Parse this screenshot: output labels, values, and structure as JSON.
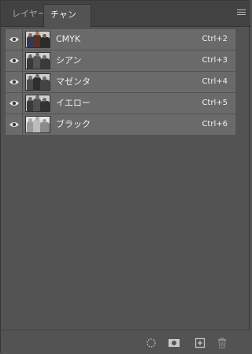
{
  "tabs": [
    {
      "label": "レイヤー",
      "active": false
    },
    {
      "label": "チャンネル",
      "active": true
    }
  ],
  "channels": [
    {
      "name": "CMYK",
      "shortcut": "Ctrl+2",
      "thumb": "composite-cmyk"
    },
    {
      "name": "シアン",
      "shortcut": "Ctrl+3",
      "thumb": "cyan"
    },
    {
      "name": "マゼンタ",
      "shortcut": "Ctrl+4",
      "thumb": "magenta"
    },
    {
      "name": "イエロー",
      "shortcut": "Ctrl+5",
      "thumb": "yellow"
    },
    {
      "name": "ブラック",
      "shortcut": "Ctrl+6",
      "thumb": "black"
    }
  ],
  "footer_icons": [
    "load-selection-icon",
    "save-selection-icon",
    "new-channel-icon",
    "delete-channel-icon"
  ],
  "colors": {
    "panel_bg": "#535353",
    "row_bg": "#6a6a6a",
    "tabbar_bg": "#424242"
  }
}
